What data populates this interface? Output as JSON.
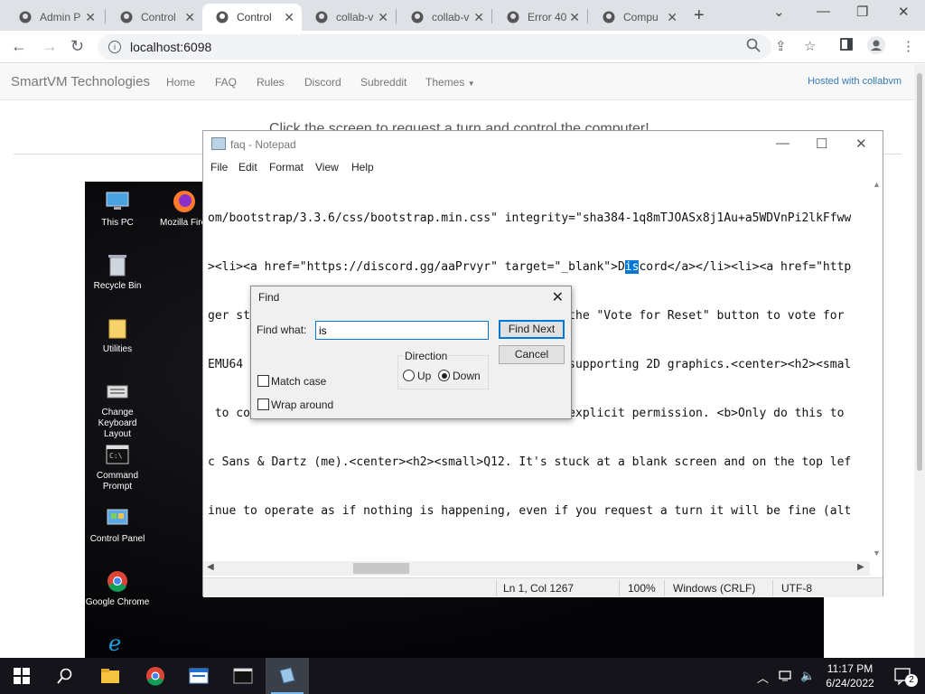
{
  "browser": {
    "tabs": [
      {
        "title": "Admin P",
        "icon": "github-icon"
      },
      {
        "title": "Control",
        "icon": "github-icon"
      },
      {
        "title": "Control",
        "icon": "github-icon",
        "active": true
      },
      {
        "title": "collab-v",
        "icon": "github-icon"
      },
      {
        "title": "collab-v",
        "icon": "github-icon"
      },
      {
        "title": "Error 40",
        "icon": "github-icon"
      },
      {
        "title": "Compu",
        "icon": "github-icon"
      }
    ],
    "url": "localhost:6098"
  },
  "site": {
    "brand": "SmartVM Technologies",
    "nav": [
      "Home",
      "FAQ",
      "Rules",
      "Discord",
      "Subreddit",
      "Themes"
    ],
    "hosted": "Hosted with collabvm",
    "headline": "Click the screen to request a turn and control the computer!"
  },
  "desktop": {
    "icons": [
      {
        "label": "This PC",
        "icon": "this-pc-icon"
      },
      {
        "label": "Mozilla Firef",
        "icon": "firefox-icon"
      },
      {
        "label": "Recycle Bin",
        "icon": "recycle-bin-icon"
      },
      {
        "label": "Utilities",
        "icon": "folder-icon"
      },
      {
        "label": "Change Keyboard Layout",
        "icon": "keyboard-icon"
      },
      {
        "label": "Command Prompt",
        "icon": "cmd-icon"
      },
      {
        "label": "Control Panel",
        "icon": "control-panel-icon"
      },
      {
        "label": "Google Chrome",
        "icon": "chrome-icon"
      },
      {
        "label": "",
        "icon": "ie-icon"
      }
    ]
  },
  "notepad": {
    "title": "faq - Notepad",
    "menu": [
      "File",
      "Edit",
      "Format",
      "View",
      "Help"
    ],
    "lines": [
      {
        "pre": "om/bootstrap/3.3.6/css/bootstrap.min.css\" integrity=\"sha384-1q8mTJOASx8j1Au+a5WDVnPi2lkFfww",
        "hl": "",
        "post": ""
      },
      {
        "pre": "><li><a href=\"https://discord.gg/aaPrvyr\" target=\"_blank\">D",
        "hl": "is",
        "post": "cord</a></li><li><a href=\"http"
      },
      {
        "pre": "ger start or is really messed up, you should click the \"Vote for Reset\" button to vote for",
        "hl": "",
        "post": ""
      },
      {
        "pre": "EMU64 CPU @ 2 GHz, and a QXL video card capable of supporting 2D graphics.<center><h2><smal",
        "hl": "",
        "post": ""
      },
      {
        "pre": " to control the virtual machine unless you have my explicit permission. <b>Only do this to",
        "hl": "",
        "post": ""
      },
      {
        "pre": "c Sans & Dartz (me).<center><h2><small>Q12. It's stuck at a blank screen and on the top lef",
        "hl": "",
        "post": ""
      },
      {
        "pre": "inue to operate as if nothing is happening, even if you request a turn it will be fine (alt",
        "hl": "",
        "post": ""
      }
    ],
    "status": {
      "position": "Ln 1, Col 1267",
      "zoom": "100%",
      "eol": "Windows (CRLF)",
      "encoding": "UTF-8"
    }
  },
  "find": {
    "title": "Find",
    "find_what_label": "Find what:",
    "find_what_value": "is",
    "find_next": "Find Next",
    "cancel": "Cancel",
    "direction_label": "Direction",
    "up": "Up",
    "down": "Down",
    "direction_selected": "Down",
    "match_case": "Match case",
    "match_case_checked": false,
    "wrap_around": "Wrap around",
    "wrap_around_checked": false
  },
  "taskbar": {
    "time": "11:17 PM",
    "date": "6/24/2022",
    "notifications": "2"
  }
}
